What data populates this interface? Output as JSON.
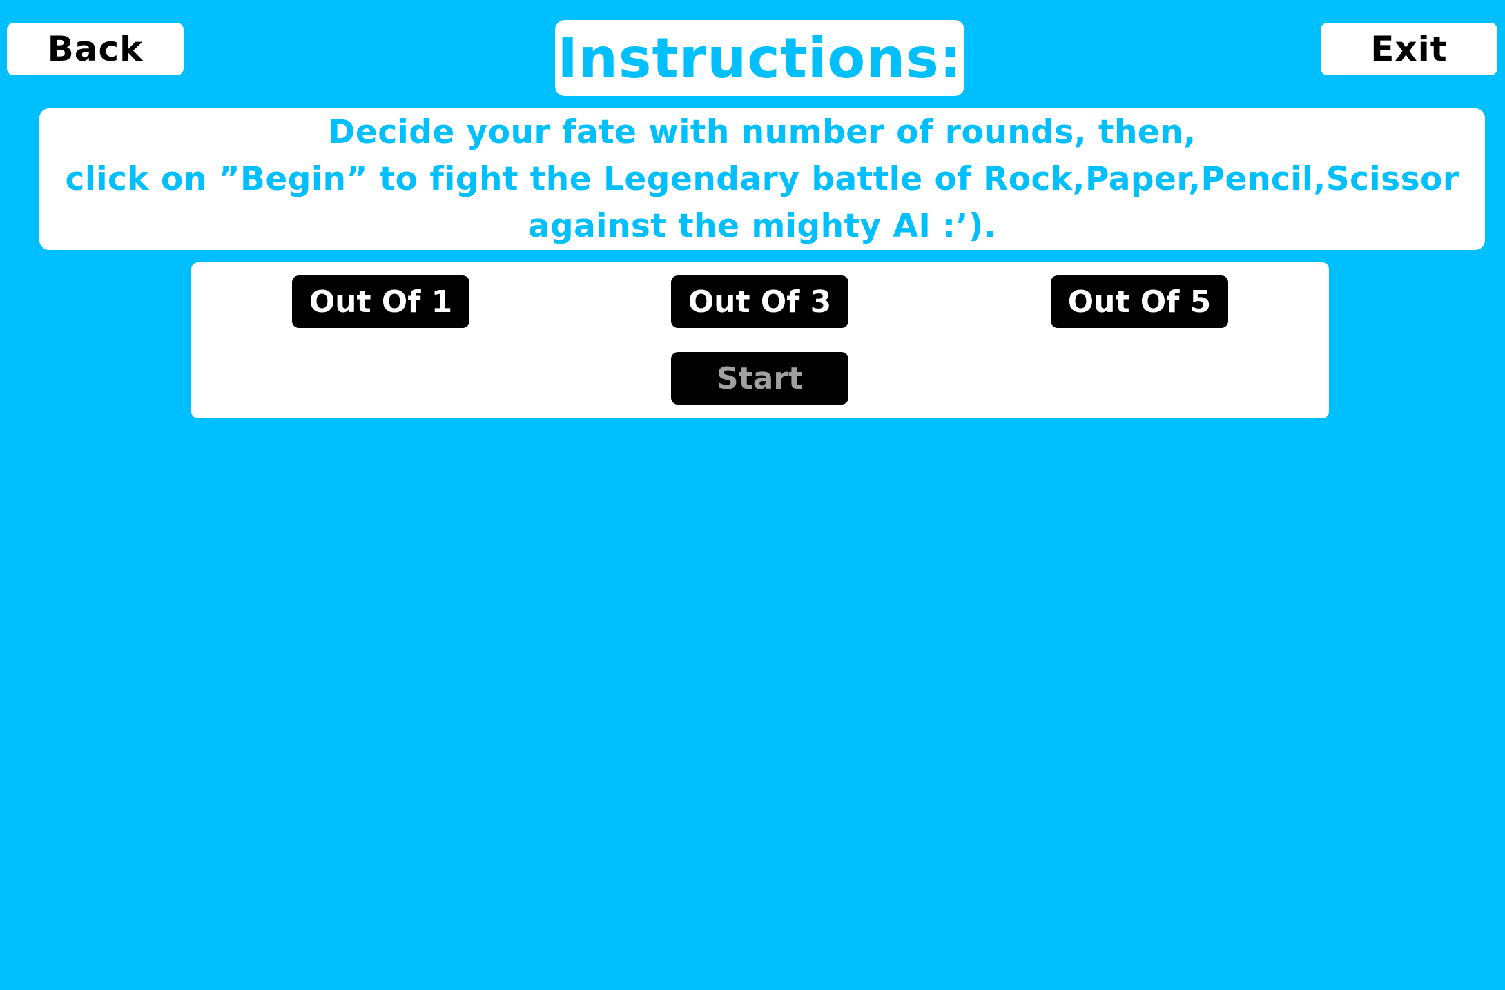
{
  "header": {
    "back_label": "Back",
    "title": "Instructions:",
    "exit_label": "Exit"
  },
  "instructions": {
    "lines": [
      "Decide your fate with number of rounds, then,",
      "click on ”Begin” to fight the Legendary battle of Rock,Paper,Pencil,Scissor",
      "against the mighty AI :’)."
    ]
  },
  "rounds": {
    "options": [
      "Out Of 1",
      "Out Of 3",
      "Out Of 5"
    ],
    "start_label": "Start",
    "start_enabled": false
  },
  "colors": {
    "background": "#00BFFF",
    "panel": "#FFFFFF",
    "accent_text": "#00BFFF",
    "button_dark": "#000000",
    "disabled_text": "#A0A0A0"
  }
}
